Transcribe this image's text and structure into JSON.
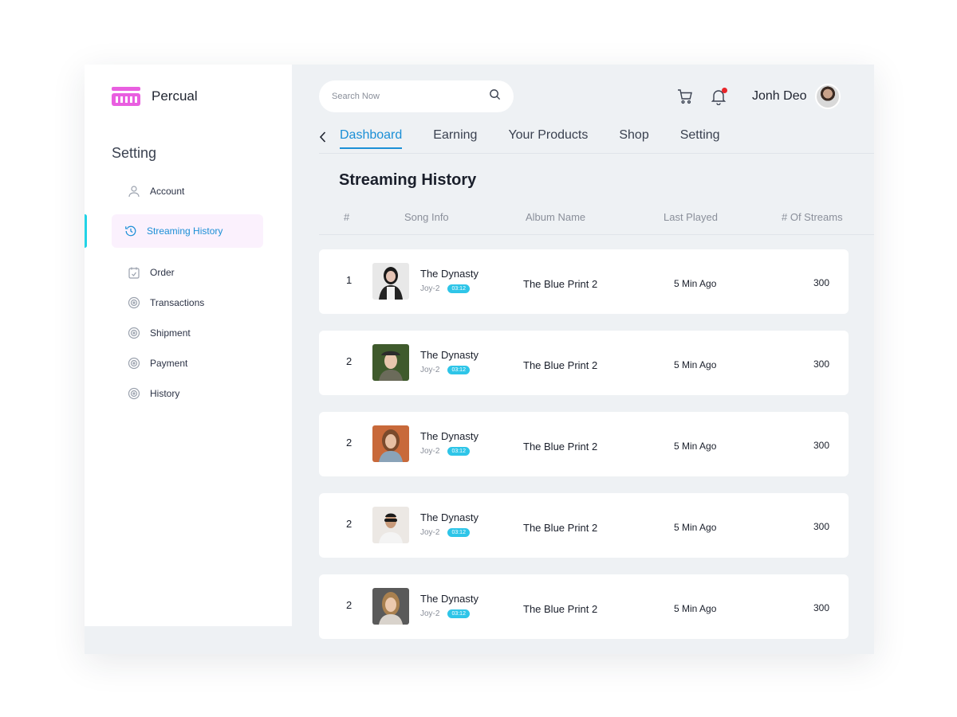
{
  "brand": {
    "name": "Percual",
    "logo_color": "#e95fe0"
  },
  "sidebar": {
    "section_title": "Setting",
    "items": [
      {
        "label": "Account",
        "icon": "user-icon",
        "active": false
      },
      {
        "label": "Streaming History",
        "icon": "history-icon",
        "active": true
      },
      {
        "label": "Order",
        "icon": "order-icon",
        "active": false
      },
      {
        "label": "Transactions",
        "icon": "transactions-icon",
        "active": false
      },
      {
        "label": "Shipment",
        "icon": "shipment-icon",
        "active": false
      },
      {
        "label": "Payment",
        "icon": "payment-icon",
        "active": false
      },
      {
        "label": "History",
        "icon": "history-list-icon",
        "active": false
      }
    ]
  },
  "search": {
    "placeholder": "Search Now"
  },
  "user": {
    "name": "Jonh Deo"
  },
  "tabs": [
    {
      "label": "Dashboard",
      "active": true
    },
    {
      "label": "Earning",
      "active": false
    },
    {
      "label": "Your Products",
      "active": false
    },
    {
      "label": "Shop",
      "active": false
    },
    {
      "label": "Setting",
      "active": false
    }
  ],
  "page": {
    "title": "Streaming History"
  },
  "table": {
    "headers": [
      "#",
      "Song Info",
      "Album Name",
      "Last Played",
      "# Of Streams"
    ],
    "rows": [
      {
        "num": "1",
        "title": "The Dynasty",
        "artist": "Joy-2",
        "duration": "03:12",
        "album": "The Blue Print 2",
        "last_played": "5 Min Ago",
        "streams": "300"
      },
      {
        "num": "2",
        "title": "The Dynasty",
        "artist": "Joy-2",
        "duration": "03:12",
        "album": "The Blue Print 2",
        "last_played": "5 Min Ago",
        "streams": "300"
      },
      {
        "num": "2",
        "title": "The Dynasty",
        "artist": "Joy-2",
        "duration": "03:12",
        "album": "The Blue Print 2",
        "last_played": "5 Min Ago",
        "streams": "300"
      },
      {
        "num": "2",
        "title": "The Dynasty",
        "artist": "Joy-2",
        "duration": "03:12",
        "album": "The Blue Print 2",
        "last_played": "5 Min Ago",
        "streams": "300"
      },
      {
        "num": "2",
        "title": "The Dynasty",
        "artist": "Joy-2",
        "duration": "03:12",
        "album": "The Blue Print 2",
        "last_played": "5 Min Ago",
        "streams": "300"
      }
    ]
  },
  "colors": {
    "accent": "#1b8fd6",
    "active_bar": "#22d3e6",
    "badge": "#2ec5e8",
    "notification": "#e8262a"
  }
}
